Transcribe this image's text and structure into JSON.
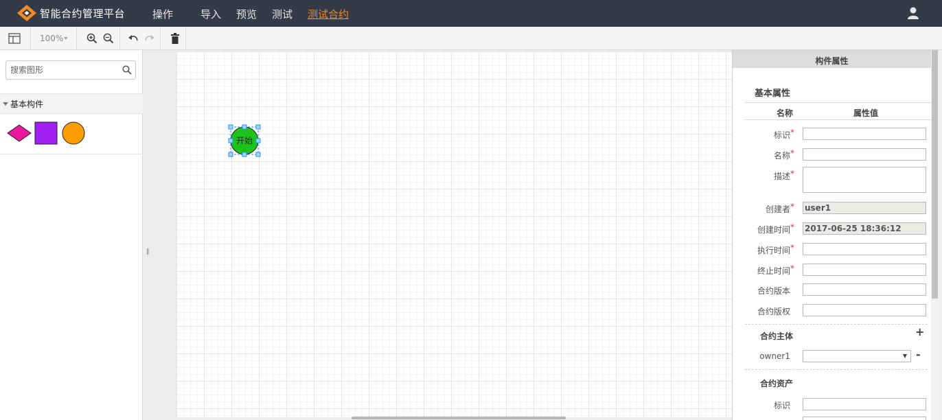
{
  "app": {
    "title": "智能合约管理平台",
    "accent_color": "#f08a24",
    "nav_items": [
      {
        "label": "操作"
      },
      {
        "label": "导入"
      },
      {
        "label": "预览"
      },
      {
        "label": "测试"
      },
      {
        "label": "测试合约",
        "active": true
      }
    ],
    "user_icon": "user-icon"
  },
  "toolbar": {
    "zoom": "100%",
    "buttons": [
      "panel-toggle-icon",
      "zoom-in-icon",
      "zoom-out-icon",
      "undo-icon",
      "redo-icon",
      "delete-icon"
    ]
  },
  "sidebar": {
    "search_placeholder": "搜索图形",
    "palette_title": "基本构件",
    "shapes": [
      {
        "name": "diamond-shape",
        "color": "#e8199b"
      },
      {
        "name": "square-shape",
        "color": "#a020f0"
      },
      {
        "name": "circle-shape",
        "color": "#ff9c00"
      }
    ]
  },
  "canvas": {
    "node": {
      "label": "开始",
      "color": "#1dc21d",
      "selected": true
    }
  },
  "panel": {
    "header": "构件属性",
    "section_basic": "基本属性",
    "col_name": "名称",
    "col_value": "属性值",
    "fields": [
      {
        "label": "标识",
        "required": "*",
        "value": ""
      },
      {
        "label": "名称",
        "required": "*",
        "value": ""
      },
      {
        "label": "描述",
        "required": "*",
        "value": ""
      },
      {
        "label": "创建者",
        "required": "*",
        "value": "user1"
      },
      {
        "label": "创建时间",
        "required": "*",
        "value": "2017-06-25 18:36:12"
      },
      {
        "label": "执行时间",
        "required": "*",
        "value": ""
      },
      {
        "label": "终止时间",
        "required": "*",
        "value": ""
      },
      {
        "label": "合约版本",
        "required": "",
        "value": ""
      },
      {
        "label": "合约版权",
        "required": "",
        "value": ""
      }
    ],
    "parties": {
      "title": "合约主体",
      "add_label": "+",
      "owner_label": "owner1",
      "owner_value": "",
      "remove_label": "-"
    },
    "assets": {
      "title": "合约资产",
      "id_label": "标识",
      "id_value": ""
    }
  }
}
